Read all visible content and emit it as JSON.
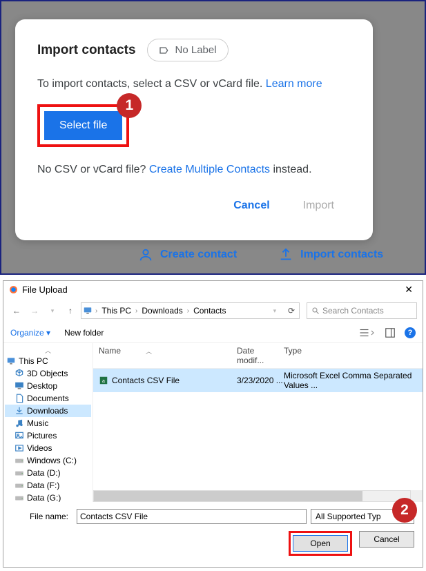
{
  "modal": {
    "title": "Import contacts",
    "label_chip": "No Label",
    "description_pre": "To import contacts, select a CSV or vCard file. ",
    "learn_more": "Learn more",
    "select_file": "Select file",
    "alt_pre": "No CSV or vCard file? ",
    "alt_link": "Create Multiple Contacts",
    "alt_post": " instead.",
    "cancel": "Cancel",
    "import": "Import"
  },
  "markers": {
    "one": "1",
    "two": "2"
  },
  "bg": {
    "create": "Create contact",
    "import": "Import contacts"
  },
  "dialog": {
    "title": "File Upload",
    "path_segments": [
      "This PC",
      "Downloads",
      "Contacts"
    ],
    "search_placeholder": "Search Contacts",
    "organize": "Organize",
    "newfolder": "New folder",
    "columns": {
      "name": "Name",
      "date": "Date modif...",
      "type": "Type"
    },
    "tree": [
      {
        "label": "This PC",
        "icon": "pc",
        "root": true
      },
      {
        "label": "3D Objects",
        "icon": "3d"
      },
      {
        "label": "Desktop",
        "icon": "desktop"
      },
      {
        "label": "Documents",
        "icon": "docs"
      },
      {
        "label": "Downloads",
        "icon": "downloads",
        "selected": true
      },
      {
        "label": "Music",
        "icon": "music"
      },
      {
        "label": "Pictures",
        "icon": "pictures"
      },
      {
        "label": "Videos",
        "icon": "videos"
      },
      {
        "label": "Windows (C:)",
        "icon": "drive"
      },
      {
        "label": "Data (D:)",
        "icon": "drive"
      },
      {
        "label": "Data (F:)",
        "icon": "drive"
      },
      {
        "label": "Data (G:)",
        "icon": "drive"
      }
    ],
    "files": [
      {
        "name": "Contacts CSV File",
        "date": "3/23/2020 ...",
        "type": "Microsoft Excel Comma Separated Values ...",
        "selected": true
      }
    ],
    "filename_label": "File name:",
    "filename_value": "Contacts CSV File",
    "filetype": "All Supported Typ",
    "open": "Open",
    "cancel": "Cancel"
  }
}
